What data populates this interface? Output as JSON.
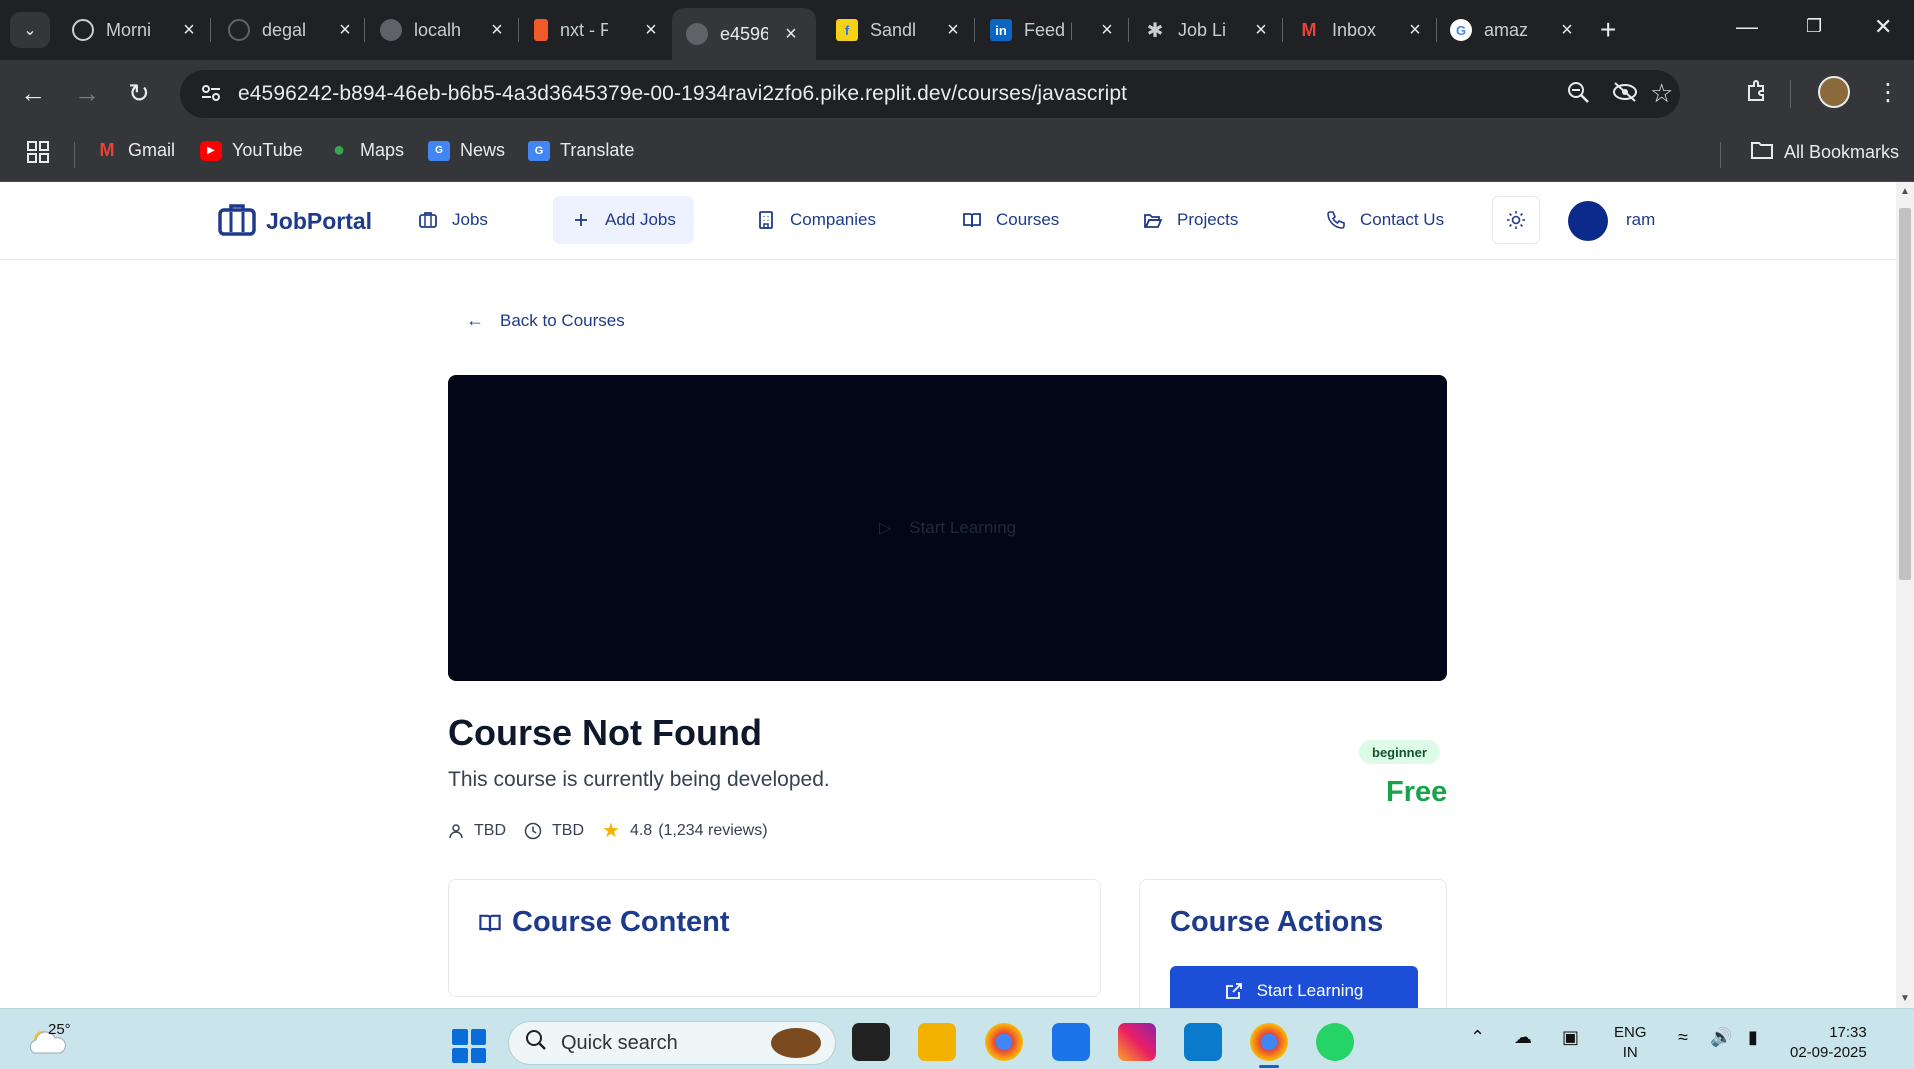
{
  "browser": {
    "tabs": [
      {
        "label": "Morni",
        "icon": "openai-icon",
        "color": "#202124"
      },
      {
        "label": "degal",
        "icon": "github-icon",
        "color": "#202124"
      },
      {
        "label": "localh",
        "icon": "globe-icon",
        "color": "#5f6368"
      },
      {
        "label": "nxt - F",
        "icon": "nxt-icon",
        "color": "#f05a28"
      },
      {
        "label": "e4596",
        "icon": "replit-icon",
        "color": "#5f6368",
        "active": true
      },
      {
        "label": "Sandl",
        "icon": "flipkart-icon",
        "color": "#f7d117"
      },
      {
        "label": "Feed |",
        "icon": "linkedin-icon",
        "color": "#0a66c2"
      },
      {
        "label": "Job Li",
        "icon": "asterisk-icon",
        "color": "#202124"
      },
      {
        "label": "Inbox",
        "icon": "gmail-icon",
        "color": "#ea4335"
      },
      {
        "label": "amaz",
        "icon": "google-icon",
        "color": "#ffffff"
      }
    ],
    "url": "e4596242-b894-46eb-b6b5-4a3d3645379e-00-1934ravi2zfo6.pike.replit.dev/courses/javascript",
    "bookmarks": [
      {
        "label": "Gmail",
        "icon": "gmail-icon"
      },
      {
        "label": "YouTube",
        "icon": "youtube-icon"
      },
      {
        "label": "Maps",
        "icon": "maps-icon"
      },
      {
        "label": "News",
        "icon": "news-icon"
      },
      {
        "label": "Translate",
        "icon": "translate-icon"
      }
    ],
    "all_bookmarks": "All Bookmarks"
  },
  "navbar": {
    "logo": "JobPortal",
    "items": [
      {
        "label": "Jobs",
        "icon": "briefcase-icon"
      },
      {
        "label": "Add Jobs",
        "icon": "plus-icon"
      },
      {
        "label": "Companies",
        "icon": "building-icon"
      },
      {
        "label": "Courses",
        "icon": "book-icon"
      },
      {
        "label": "Projects",
        "icon": "folder-icon"
      },
      {
        "label": "Contact Us",
        "icon": "phone-icon"
      }
    ],
    "user": "ram"
  },
  "course": {
    "back": "Back to Courses",
    "video_label": "Start Learning",
    "title": "Course Not Found",
    "description": "This course is currently being developed.",
    "instructor": "TBD",
    "duration": "TBD",
    "rating": "4.8",
    "reviews": "(1,234 reviews)",
    "level": "beginner",
    "price": "Free",
    "content_title": "Course Content",
    "actions_title": "Course Actions",
    "start_button": "Start Learning"
  },
  "taskbar": {
    "temperature": "25°",
    "search_placeholder": "Quick search",
    "language_line1": "ENG",
    "language_line2": "IN",
    "time": "17:33",
    "date": "02-09-2025"
  },
  "colors": {
    "brand": "#1e3a8a",
    "price_green": "#16a34a",
    "button_blue": "#1d4ed8",
    "video_bg": "#020617"
  }
}
